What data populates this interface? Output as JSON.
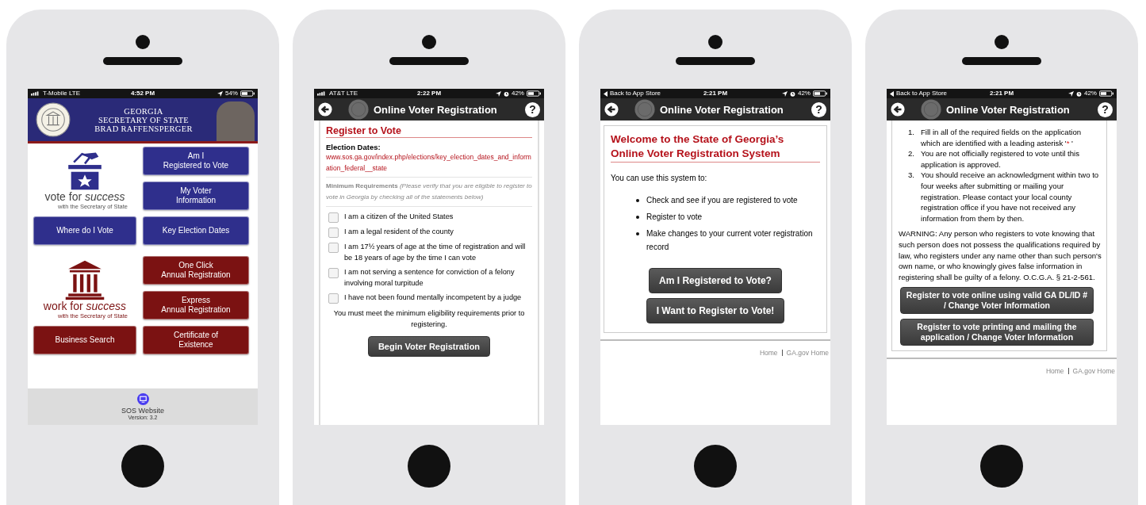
{
  "phones": [
    {
      "kind": "home",
      "status_bar": {
        "kind": "carrier",
        "carrier": "T-Mobile  LTE",
        "time": "4:52 PM",
        "alarm": false,
        "battery": "54%"
      },
      "header": {
        "title": "GEORGIA\nSECRETARY OF STATE\nBRAD RAFFENSPERGER"
      },
      "sections": [
        {
          "color": "#2f2f8c",
          "logo": {
            "kind": "ballot",
            "text": "vote for *success*",
            "tagline": "with the Secretary of State"
          },
          "buttons": [
            "Am I\nRegistered to Vote",
            "My Voter\nInformation",
            "Where do I Vote",
            "Key Election Dates"
          ]
        },
        {
          "color": "#7b1212",
          "logo": {
            "kind": "building",
            "text": "work for *success*",
            "tagline": "with the Secretary of State"
          },
          "buttons": [
            "One Click\nAnnual Registration",
            "Express\nAnnual Registration",
            "Business Search",
            "Certificate of\nExistence"
          ]
        }
      ],
      "footer": {
        "link": "SOS Website",
        "version": "Version: 3.2"
      }
    },
    {
      "kind": "requirements",
      "status_bar": {
        "kind": "carrier",
        "carrier": "AT&T  LTE",
        "time": "2:22 PM",
        "alarm": true,
        "battery": "42%"
      },
      "title_bar": {
        "title": "Online Voter Registration",
        "help": "?"
      },
      "heading": "Register to Vote",
      "dates_label": "Election Dates:",
      "dates_link": "www.sos.ga.gov/index.php/elections/key_election_dates_and_information_federal__state",
      "requirements": "**Minimum Requirements** *(Please verify that you are eligible to register to vote in Georgia by checking all of the statements below)*",
      "checks": [
        {
          "label": "I am a citizen of the United States",
          "checked": false
        },
        {
          "label": "I am a legal resident of the county",
          "checked": false
        },
        {
          "label": "I am 17½ years of age at the time of registration and will be 18 years of age by the time I can vote",
          "checked": false
        },
        {
          "label": "I am not serving a sentence for conviction of a felony involving moral turpitude",
          "checked": false
        },
        {
          "label": "I have not been found mentally incompetent by a judge",
          "checked": false
        }
      ],
      "note": "You must meet the minimum eligibility requirements prior to registering.",
      "button": "Begin Voter Registration"
    },
    {
      "kind": "welcome",
      "status_bar": {
        "kind": "back",
        "carrier": "Back to App Store",
        "time": "2:21 PM",
        "alarm": true,
        "battery": "42%"
      },
      "title_bar": {
        "title": "Online Voter Registration",
        "help": "?"
      },
      "heading": "Welcome to the State of Georgia’s Online Voter Registration System",
      "intro": "You can use this system to:",
      "bullets": [
        "Check and see if you are registered to vote",
        "Register to vote",
        "Make changes to your current voter registration record"
      ],
      "buttons": [
        "Am I Registered to Vote?",
        "I Want to Register to Vote!"
      ],
      "links": [
        "Home",
        "GA.gov Home"
      ]
    },
    {
      "kind": "instructions",
      "status_bar": {
        "kind": "back",
        "carrier": "Back to App Store",
        "time": "2:21 PM",
        "alarm": true,
        "battery": "42%"
      },
      "title_bar": {
        "title": "Online Voter Registration",
        "help": "?"
      },
      "steps": [
        {
          "number": "1.",
          "text": "Fill in all of the required fields on the application which are identified with a leading asterisk '",
          "mark": "*",
          "after": " '"
        },
        {
          "number": "2.",
          "text": "You are not officially registered to vote until this application is approved."
        },
        {
          "number": "3.",
          "text": "You should receive an acknowledgment within two to four weeks after submitting or mailing your registration.  Please contact your local county registration office if you have not received any information from them by then."
        }
      ],
      "warning": "WARNING: Any person who registers to vote knowing that such person does not possess the qualifications required by law, who registers under any name other than such person's own name, or who knowingly gives false information in registering shall be guilty of a felony. O.C.G.A. § 21-2-561.",
      "buttons": [
        "Register to vote online using valid GA DL/ID # / Change Voter Information",
        "Register to vote printing and mailing the application / Change Voter Information"
      ],
      "links": [
        "Home",
        "GA.gov Home"
      ]
    }
  ]
}
